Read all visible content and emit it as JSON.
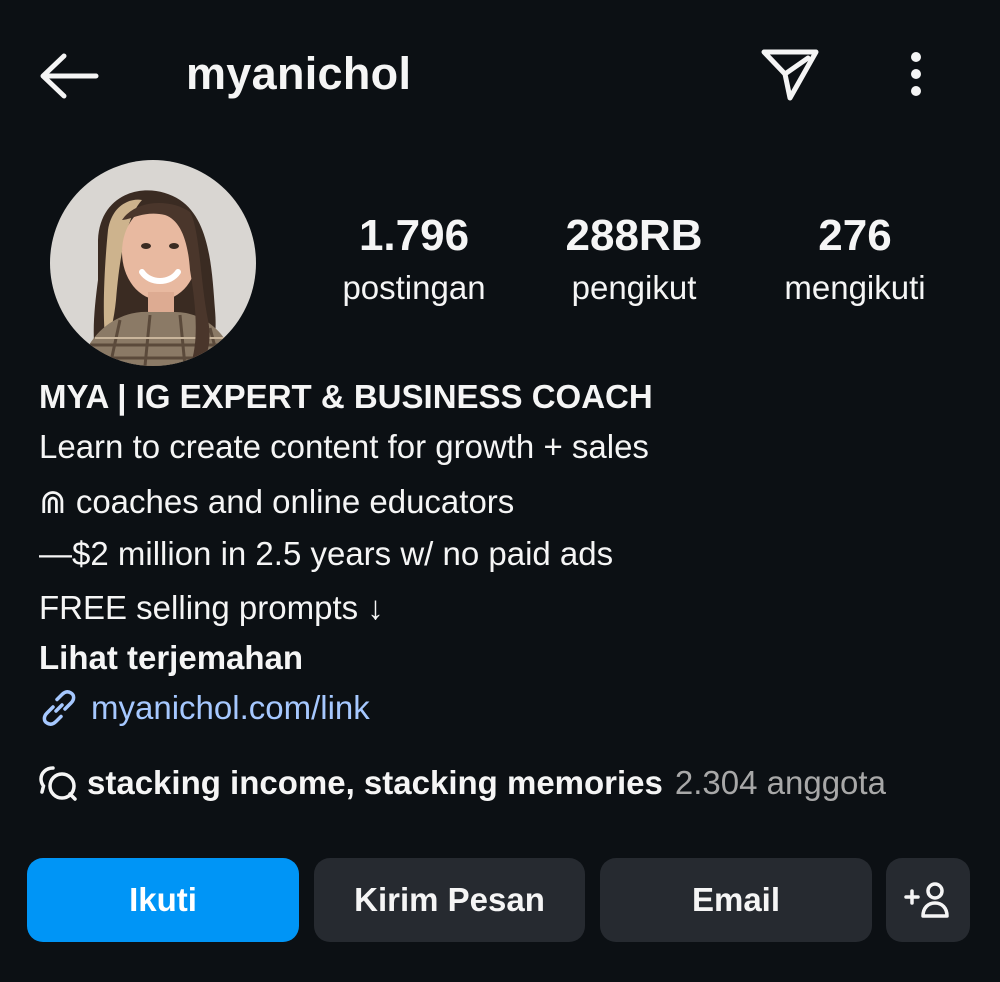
{
  "header": {
    "username": "myanichol",
    "icons": {
      "back": "back-arrow-icon",
      "send": "paper-plane-icon",
      "more": "more-vertical-icon"
    }
  },
  "profile": {
    "stats": [
      {
        "value": "1.796",
        "label": "postingan"
      },
      {
        "value": "288RB",
        "label": "pengikut"
      },
      {
        "value": "276",
        "label": "mengikuti"
      }
    ]
  },
  "bio": {
    "name": "MYA | IG EXPERT & BUSINESS COACH",
    "lines": [
      "Learn to create content for growth + sales",
      "⋒ coaches and online educators",
      "—$2 million in 2.5 years w/ no paid ads",
      "FREE selling prompts ↓"
    ],
    "translate_label": "Lihat terjemahan",
    "link": "myanichol.com/link",
    "channel": {
      "name": "stacking income, stacking memories",
      "members": "2.304 anggota"
    }
  },
  "actions": {
    "follow": "Ikuti",
    "message": "Kirim Pesan",
    "email": "Email",
    "add_user_icon": "add-person-icon"
  },
  "colors": {
    "background": "#0c1014",
    "accent": "#0095f6",
    "link": "#a6c8ff",
    "button_bg": "#262a30",
    "muted": "#a8a8a8"
  }
}
